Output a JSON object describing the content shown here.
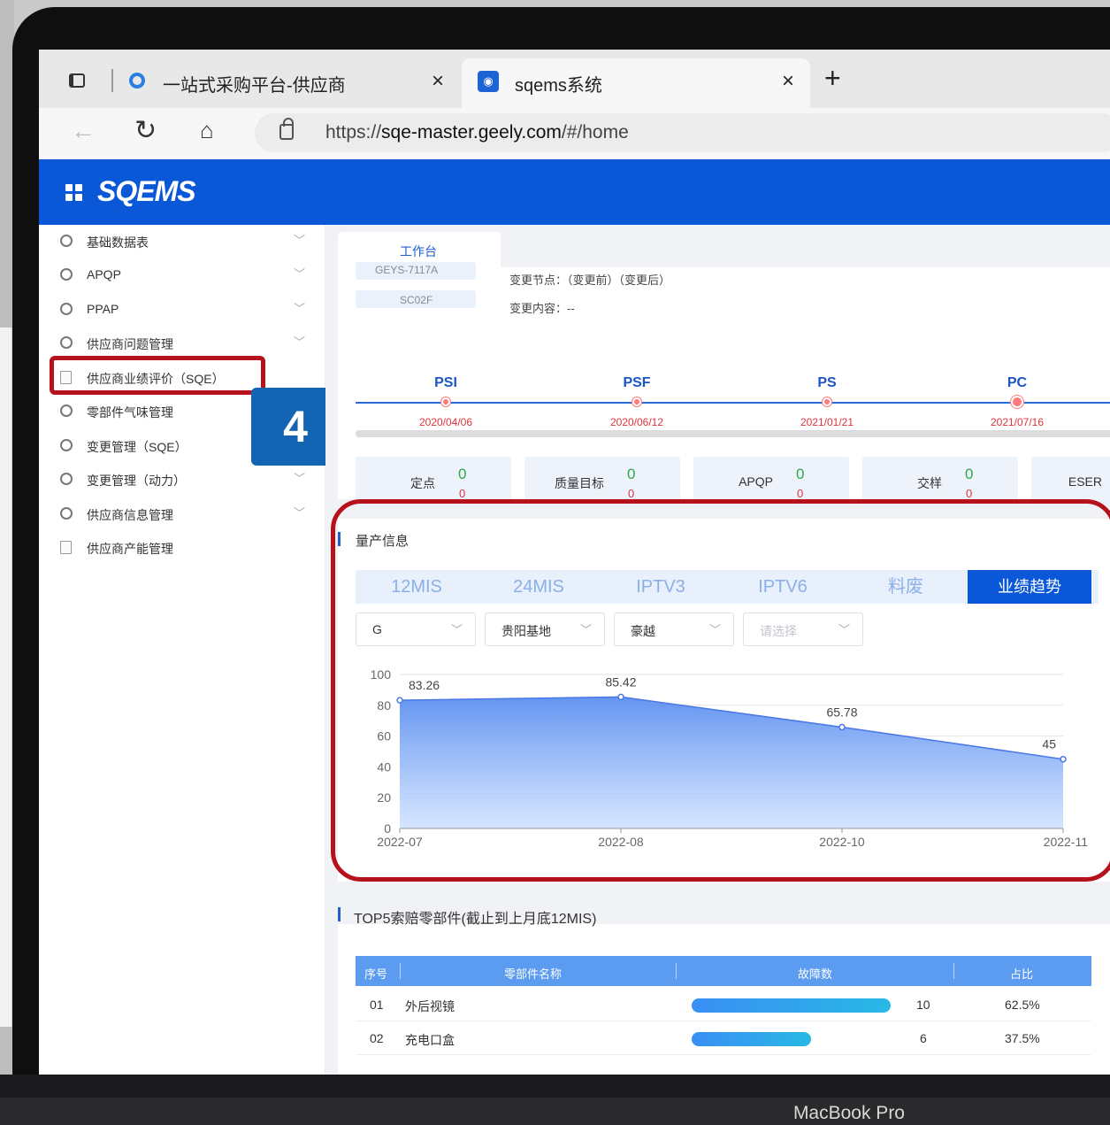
{
  "browser": {
    "tabs": [
      {
        "title": "一站式采购平台-供应商",
        "close": "×"
      },
      {
        "title": "sqems系统",
        "close": "×"
      }
    ],
    "new_tab": "+",
    "url_prefix": "https://",
    "url_domain": "sqe-master.geely.com",
    "url_path": "/#/home"
  },
  "app": {
    "logo": "SQEMS"
  },
  "sidebar": {
    "items": [
      {
        "label": "基础数据表"
      },
      {
        "label": "APQP"
      },
      {
        "label": "PPAP"
      },
      {
        "label": "供应商问题管理"
      },
      {
        "label": "供应商业绩评价（SQE）"
      },
      {
        "label": "零部件气味管理"
      },
      {
        "label": "变更管理（SQE）"
      },
      {
        "label": "变更管理（动力）"
      },
      {
        "label": "供应商信息管理"
      },
      {
        "label": "供应商产能管理"
      }
    ],
    "step_badge": "4"
  },
  "content": {
    "tab": "工作台",
    "pill1": "GEYS-7117A",
    "pill2": "SC02F",
    "change_node": "变更节点：（变更前）（变更后）",
    "change_content": "变更内容：--",
    "milestones": [
      {
        "name": "PSI",
        "date": "2020/04/06"
      },
      {
        "name": "PSF",
        "date": "2020/06/12"
      },
      {
        "name": "PS",
        "date": "2021/01/21"
      },
      {
        "name": "PC",
        "date": "2021/07/16"
      }
    ],
    "stats": [
      {
        "label": "定点",
        "green": "0",
        "red": "0"
      },
      {
        "label": "质量目标",
        "green": "0",
        "red": "0"
      },
      {
        "label": "APQP",
        "green": "0",
        "red": "0"
      },
      {
        "label": "交样",
        "green": "0",
        "red": "0"
      },
      {
        "label": "ESER",
        "green": "",
        "red": ""
      }
    ],
    "production": {
      "title": "量产信息",
      "subtabs": [
        "12MIS",
        "24MIS",
        "IPTV3",
        "IPTV6",
        "料废",
        "业绩趋势"
      ],
      "filters": [
        {
          "value": "G"
        },
        {
          "value": "贵阳基地"
        },
        {
          "value": "豪越"
        },
        {
          "value": "请选择"
        }
      ]
    },
    "top5": {
      "title": "TOP5索赔零部件(截止到上月底12MIS)",
      "headers": [
        "序号",
        "零部件名称",
        "故障数",
        "占比"
      ],
      "rows": [
        {
          "no": "01",
          "name": "外后视镜",
          "count": "10",
          "ratio": "62.5%",
          "fraction": 0.625
        },
        {
          "no": "02",
          "name": "充电口盒",
          "count": "6",
          "ratio": "37.5%",
          "fraction": 0.375
        }
      ]
    }
  },
  "chart_data": {
    "type": "area",
    "categories": [
      "2022-07",
      "2022-08",
      "2022-10",
      "2022-11"
    ],
    "values": [
      83.26,
      85.42,
      65.78,
      45
    ],
    "labels": [
      "83.26",
      "85.42",
      "65.78",
      "45"
    ],
    "yticks": [
      "0",
      "20",
      "40",
      "60",
      "80",
      "100"
    ],
    "ylim": [
      0,
      100
    ],
    "color": "#5b8ff0"
  },
  "taskbar": {
    "icons": [
      "windows-icon",
      "search-icon",
      "task-view-icon",
      "skype-icon",
      "file-explorer-icon",
      "edge-icon",
      "outlook-icon",
      "onenote-icon",
      "powerpoint-icon"
    ]
  },
  "device": {
    "label": "MacBook Pro"
  }
}
